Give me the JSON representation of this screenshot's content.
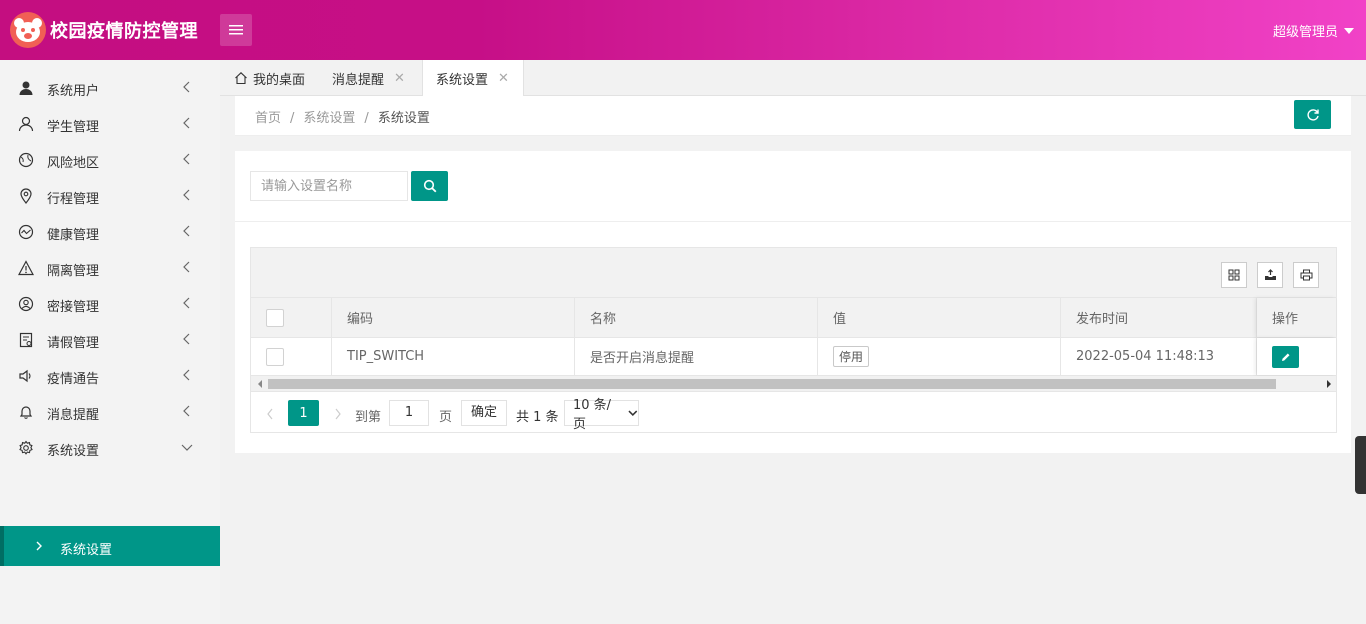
{
  "header": {
    "title": "校园疫情防控管理",
    "user": "超级管理员"
  },
  "sidebar": {
    "items": [
      {
        "label": "系统用户",
        "icon": "user-solid-icon"
      },
      {
        "label": "学生管理",
        "icon": "user-outline-icon"
      },
      {
        "label": "风险地区",
        "icon": "globe-icon"
      },
      {
        "label": "行程管理",
        "icon": "location-pin-icon"
      },
      {
        "label": "健康管理",
        "icon": "chart-wave-icon"
      },
      {
        "label": "隔离管理",
        "icon": "warning-icon"
      },
      {
        "label": "密接管理",
        "icon": "user-circle-icon"
      },
      {
        "label": "请假管理",
        "icon": "form-icon"
      },
      {
        "label": "疫情通告",
        "icon": "speaker-icon"
      },
      {
        "label": "消息提醒",
        "icon": "bell-icon"
      },
      {
        "label": "系统设置",
        "icon": "gear-icon"
      }
    ],
    "sub_item": "系统设置"
  },
  "tabs": [
    {
      "label": "我的桌面"
    },
    {
      "label": "消息提醒"
    },
    {
      "label": "系统设置"
    }
  ],
  "breadcrumb": {
    "home": "首页",
    "level1": "系统设置",
    "level2": "系统设置",
    "separator": "/"
  },
  "search": {
    "placeholder": "请输入设置名称"
  },
  "table": {
    "columns": [
      "编码",
      "名称",
      "值",
      "发布时间",
      "操作"
    ],
    "rows": [
      {
        "code": "TIP_SWITCH",
        "name": "是否开启消息提醒",
        "value_button": "停用",
        "time": "2022-05-04 11:48:13"
      }
    ]
  },
  "pager": {
    "current": "1",
    "goto_label": "到第",
    "goto_value": "1",
    "page_label": "页",
    "confirm": "确定",
    "total": "共 1 条",
    "page_size": "10 条/页"
  },
  "colors": {
    "accent": "#009688",
    "header_start": "#c40e80",
    "header_end": "#f142c7"
  }
}
